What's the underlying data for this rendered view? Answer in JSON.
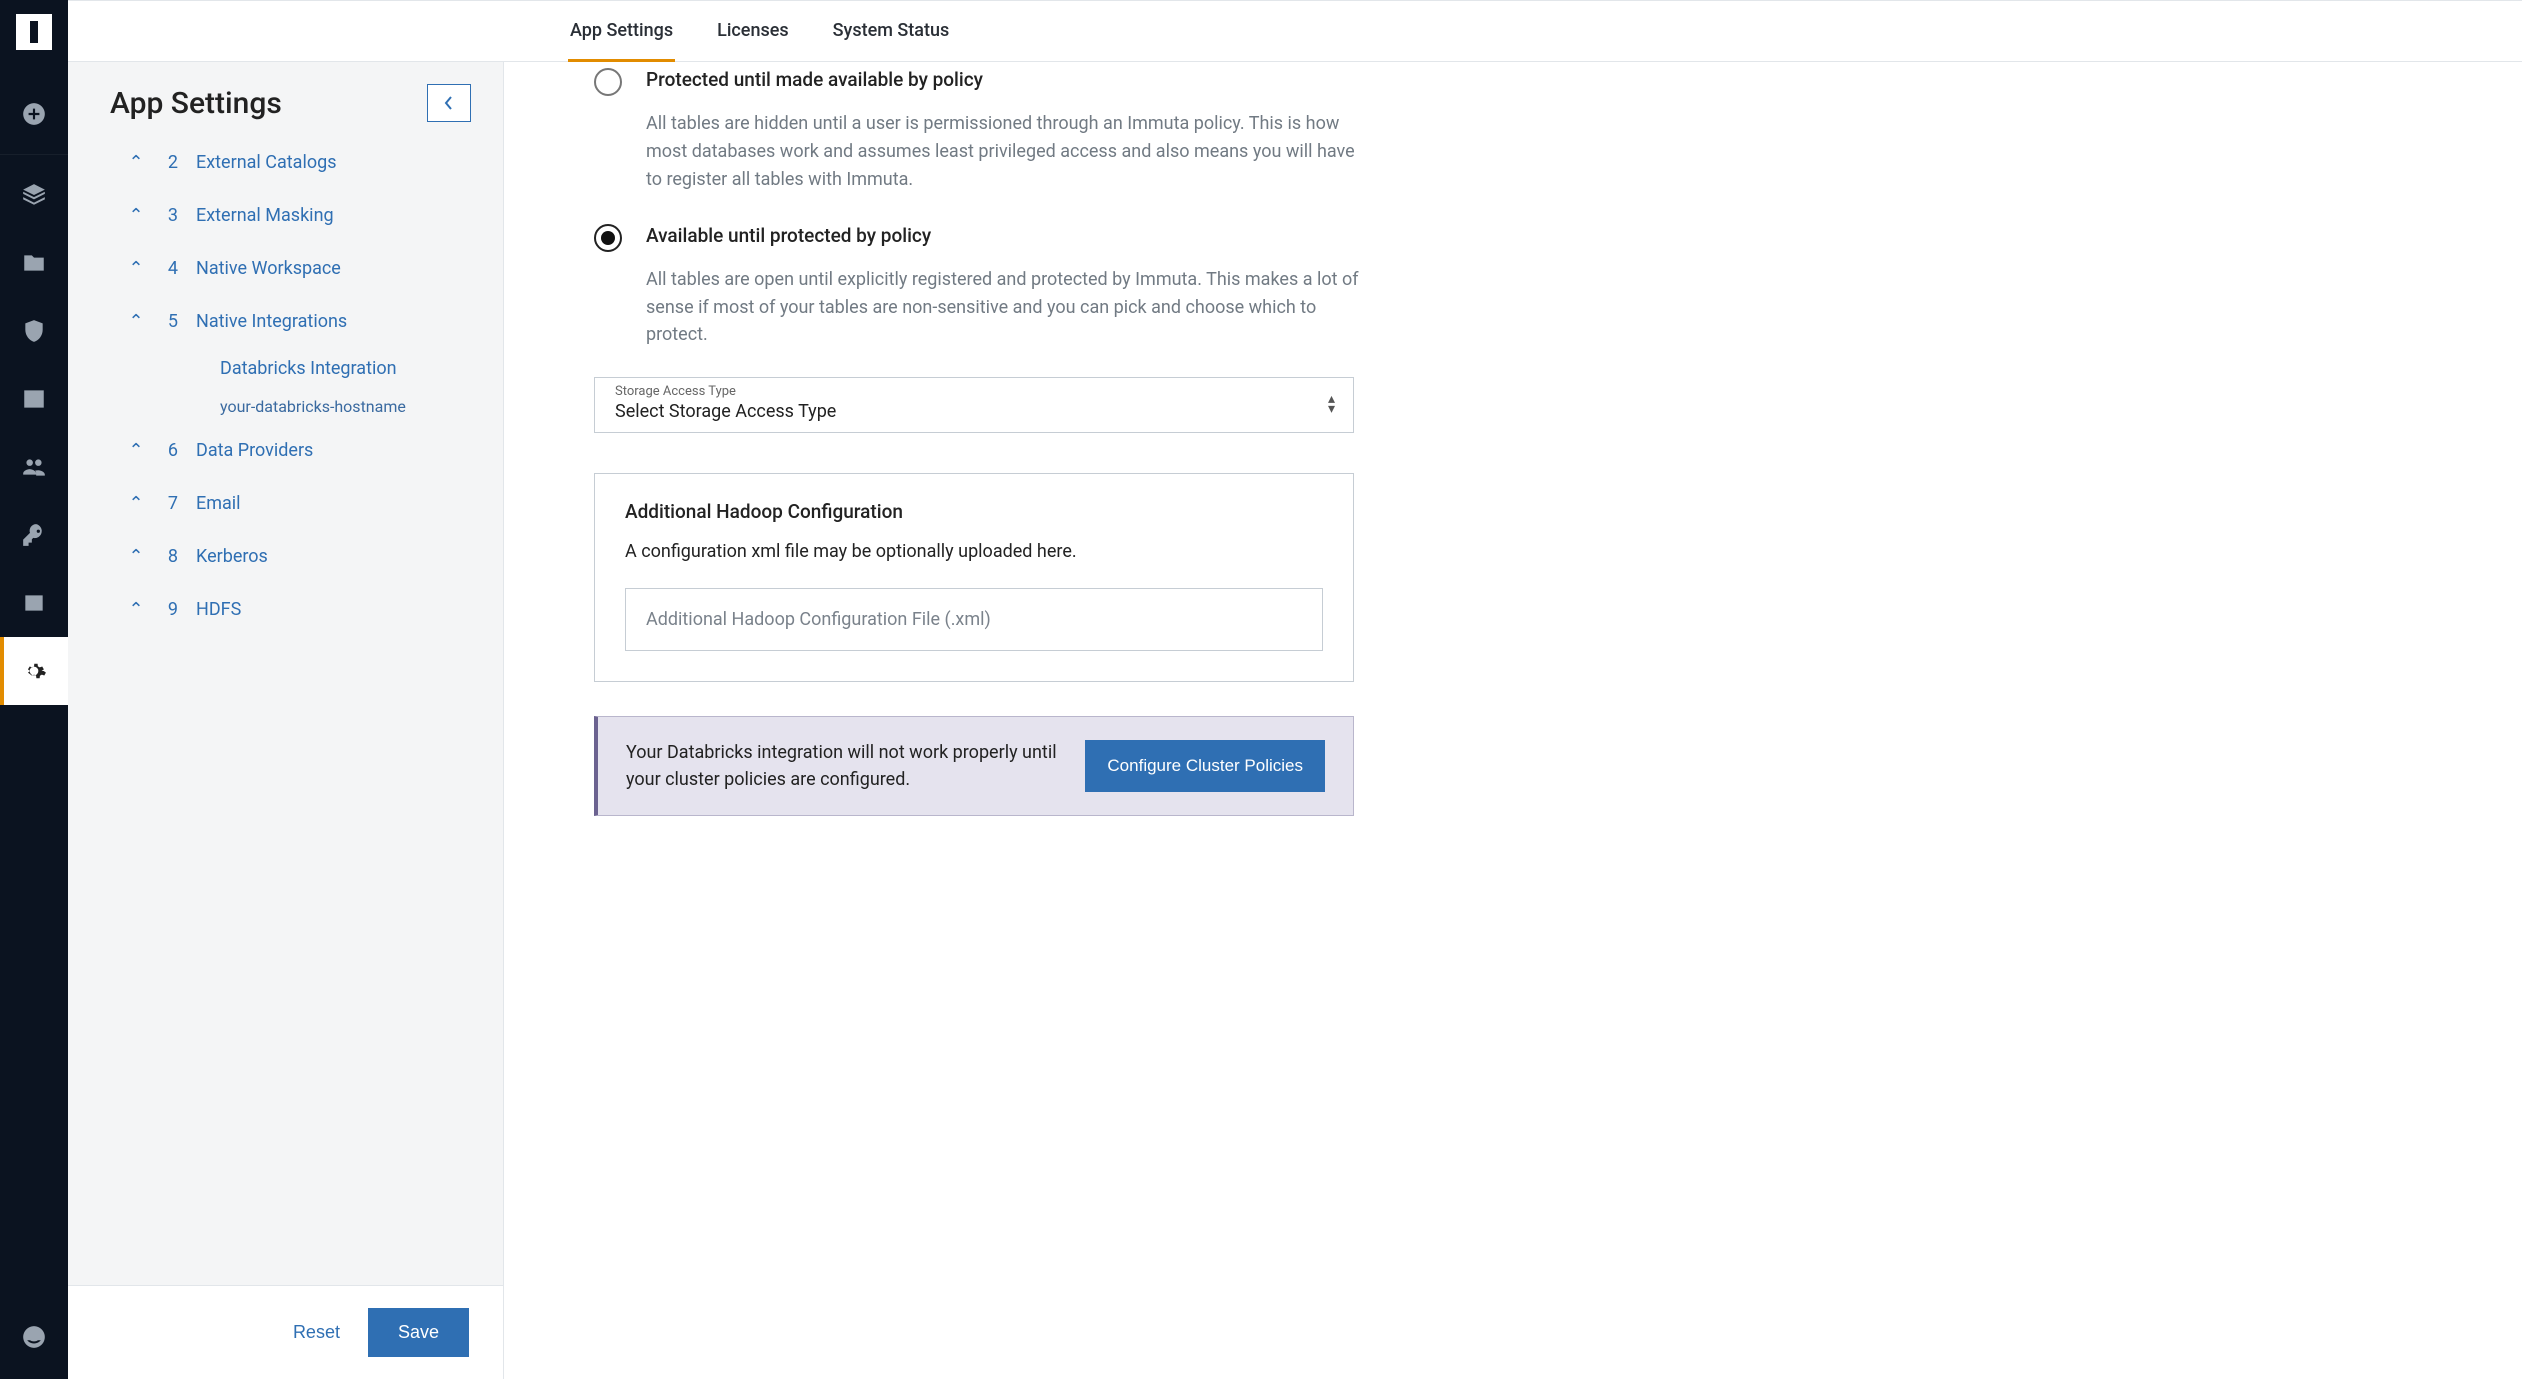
{
  "tabs": {
    "app": "App Settings",
    "licenses": "Licenses",
    "status": "System Status"
  },
  "settings_panel": {
    "title": "App Settings",
    "items": [
      {
        "num": "2",
        "label": "External Catalogs"
      },
      {
        "num": "3",
        "label": "External Masking"
      },
      {
        "num": "4",
        "label": "Native Workspace"
      },
      {
        "num": "5",
        "label": "Native Integrations"
      },
      {
        "num": "6",
        "label": "Data Providers"
      },
      {
        "num": "7",
        "label": "Email"
      },
      {
        "num": "8",
        "label": "Kerberos"
      },
      {
        "num": "9",
        "label": "HDFS"
      }
    ],
    "sub": {
      "label": "Databricks Integration",
      "host": "your-databricks-hostname"
    },
    "reset": "Reset",
    "save": "Save"
  },
  "policy": {
    "opt1": {
      "label": "Protected until made available by policy",
      "desc": "All tables are hidden until a user is permissioned through an Immuta policy. This is how most databases work and assumes least privileged access and also means you will have to register all tables with Immuta."
    },
    "opt2": {
      "label": "Available until protected by policy",
      "desc": "All tables are open until explicitly registered and protected by Immuta. This makes a lot of sense if most of your tables are non-sensitive and you can pick and choose which to protect."
    }
  },
  "storage_select": {
    "label": "Storage Access Type",
    "value": "Select Storage Access Type"
  },
  "hadoop": {
    "title": "Additional Hadoop Configuration",
    "text": "A configuration xml file may be optionally uploaded here.",
    "placeholder": "Additional Hadoop Configuration File (.xml)"
  },
  "alert": {
    "text": "Your Databricks integration will not work properly until your cluster policies are configured.",
    "button": "Configure Cluster Policies"
  }
}
